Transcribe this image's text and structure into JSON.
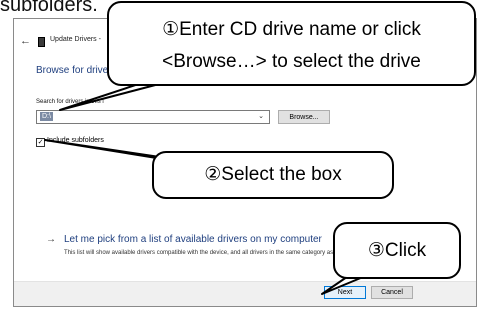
{
  "caption": "subfolders.",
  "window": {
    "title": "Update Drivers - ",
    "heading": "Browse for drive",
    "search_label": "Search for drivers in this l",
    "search_value": "D:\\",
    "browse_label": "Browse...",
    "include_subfolders_label": "Include subfolders",
    "include_subfolders_checked": true,
    "checkmark": "✓",
    "pick_title": "Let me pick from a list of available drivers on my computer",
    "pick_description": "This list will show available drivers compatible with the device, and all drivers in the same category as the device.",
    "next_label": "Next",
    "cancel_label": "Cancel"
  },
  "icons": {
    "back": "←",
    "chevron": "⌄",
    "pick_arrow": "→"
  },
  "callouts": {
    "step1_line1": "①Enter CD drive name or click",
    "step1_line2": "<Browse…> to select the drive",
    "step2": "②Select the box",
    "step3": "③Click"
  },
  "colors": {
    "accent": "#0078d7",
    "heading": "#1f3f7f"
  }
}
